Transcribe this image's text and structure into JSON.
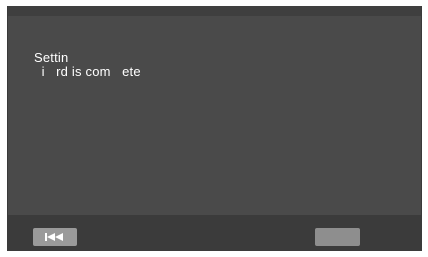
{
  "message": {
    "line1": "Settin",
    "line2": "  i   rd is com   ete"
  },
  "nav": {
    "prev_icon": "skip-to-start-icon",
    "next_label": ""
  },
  "colors": {
    "background": "#4a4a4a",
    "footer": "#3b3b3b",
    "button": "#9a9a9a",
    "text": "#ffffff",
    "icon": "#ffffff"
  }
}
